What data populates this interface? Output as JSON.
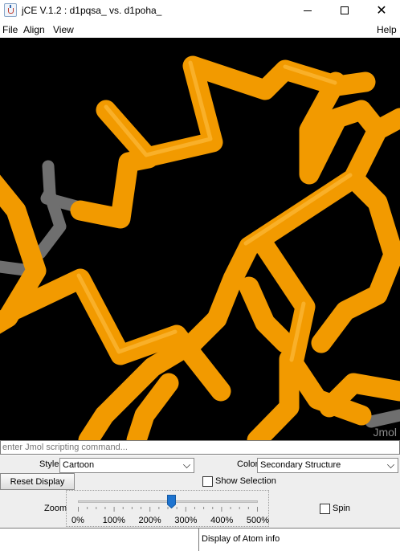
{
  "window": {
    "title": "jCE V.1.2 : d1pqsa_ vs. d1poha_",
    "app_icon": "java-cup-icon",
    "controls": {
      "minimize_icon": "minimize-icon",
      "maximize_icon": "maximize-icon",
      "close_icon": "close-icon",
      "close_glyph": "✕"
    }
  },
  "menubar": {
    "items": [
      {
        "label": "File"
      },
      {
        "label": "Align"
      },
      {
        "label": "View"
      }
    ],
    "help": "Help"
  },
  "viewer": {
    "logo": "Jmol",
    "background": "#000000",
    "backbone_color": "#f7a10a",
    "unaligned_color": "#7c7c7c"
  },
  "command": {
    "placeholder": "enter Jmol scripting command..."
  },
  "controls": {
    "style_label": "Style",
    "style_value": "Cartoon",
    "color_label": "Color",
    "color_value": "Secondary Structure",
    "reset_button": "Reset Display",
    "show_selection_label": "Show Selection",
    "show_selection_checked": false,
    "zoom_label": "Zoom",
    "zoom_percent": 260,
    "zoom_ticks": [
      "0%",
      "100%",
      "200%",
      "300%",
      "400%",
      "500%"
    ],
    "spin_label": "Spin",
    "spin_checked": false
  },
  "status": {
    "left": "",
    "right": "Display of Atom info"
  }
}
